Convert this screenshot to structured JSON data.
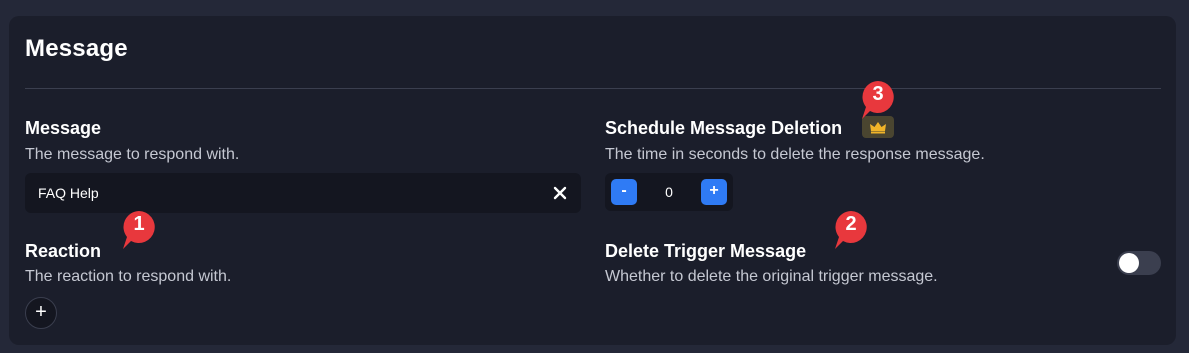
{
  "card": {
    "title": "Message"
  },
  "message": {
    "label": "Message",
    "description": "The message to respond with.",
    "value": "FAQ Help"
  },
  "reaction": {
    "label": "Reaction",
    "description": "The reaction to respond with.",
    "add_label": "+"
  },
  "schedule": {
    "label": "Schedule Message Deletion",
    "description": "The time in seconds to delete the response message.",
    "value": "0",
    "decrement_label": "-",
    "increment_label": "+",
    "premium_icon": "crown-icon"
  },
  "delete_trigger": {
    "label": "Delete Trigger Message",
    "description": "Whether to delete the original trigger message.",
    "enabled": false
  },
  "markers": [
    "1",
    "2",
    "3"
  ],
  "colors": {
    "background": "#242838",
    "card": "#1b1e2b",
    "accent": "#2f7bf5",
    "marker": "#e8383d",
    "crown": "#f0b429"
  }
}
